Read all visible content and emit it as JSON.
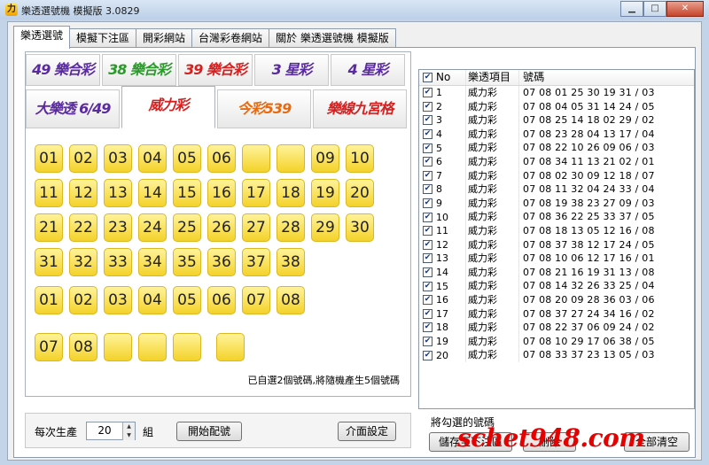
{
  "window": {
    "title": "樂透選號機 模擬版 3.0829",
    "icon_text": "力"
  },
  "tabs": [
    "樂透選號",
    "模擬下注區",
    "開彩網站",
    "台灣彩卷網站",
    "關於 樂透選號機 模擬版"
  ],
  "logos_row1": [
    "49 樂合彩",
    "38 樂合彩",
    "39 樂合彩",
    "3 星彩",
    "4 星彩"
  ],
  "logos_row2": [
    "大樂透 6/49",
    "威力彩",
    "今彩539",
    "樂線九宮格"
  ],
  "numbers": {
    "main_rows": [
      [
        "01",
        "02",
        "03",
        "04",
        "05",
        "06",
        "",
        "",
        "09",
        "10"
      ],
      [
        "11",
        "12",
        "13",
        "14",
        "15",
        "16",
        "17",
        "18",
        "19",
        "20"
      ],
      [
        "21",
        "22",
        "23",
        "24",
        "25",
        "26",
        "27",
        "28",
        "29",
        "30"
      ],
      [
        "31",
        "32",
        "33",
        "34",
        "35",
        "36",
        "37",
        "38"
      ]
    ],
    "second_rows": [
      [
        "01",
        "02",
        "03",
        "04",
        "05",
        "06",
        "07",
        "08"
      ],
      [
        "07",
        "08",
        "",
        "",
        "",
        ""
      ]
    ]
  },
  "hint": "已自選2個號碼,將隨機產生5個號碼",
  "bottom": {
    "label": "每次生產",
    "count": "20",
    "unit": "組",
    "start_button": "開始配號",
    "settings_button": "介面設定"
  },
  "list": {
    "headers": [
      "No",
      "樂透項目",
      "號碼"
    ],
    "rows": [
      {
        "no": "1",
        "game": "威力彩",
        "nums": "07 08 01 25 30 19 31 / 03"
      },
      {
        "no": "2",
        "game": "威力彩",
        "nums": "07 08 04 05 31 14 24 / 05"
      },
      {
        "no": "3",
        "game": "威力彩",
        "nums": "07 08 25 14 18 02 29 / 02"
      },
      {
        "no": "4",
        "game": "威力彩",
        "nums": "07 08 23 28 04 13 17 / 04"
      },
      {
        "no": "5",
        "game": "威力彩",
        "nums": "07 08 22 10 26 09 06 / 03"
      },
      {
        "no": "6",
        "game": "威力彩",
        "nums": "07 08 34 11 13 21 02 / 01"
      },
      {
        "no": "7",
        "game": "威力彩",
        "nums": "07 08 02 30 09 12 18 / 07"
      },
      {
        "no": "8",
        "game": "威力彩",
        "nums": "07 08 11 32 04 24 33 / 04"
      },
      {
        "no": "9",
        "game": "威力彩",
        "nums": "07 08 19 38 23 27 09 / 03"
      },
      {
        "no": "10",
        "game": "威力彩",
        "nums": "07 08 36 22 25 33 37 / 05"
      },
      {
        "no": "11",
        "game": "威力彩",
        "nums": "07 08 18 13 05 12 16 / 08"
      },
      {
        "no": "12",
        "game": "威力彩",
        "nums": "07 08 37 38 12 17 24 / 05"
      },
      {
        "no": "13",
        "game": "威力彩",
        "nums": "07 08 10 06 12 17 16 / 01"
      },
      {
        "no": "14",
        "game": "威力彩",
        "nums": "07 08 21 16 19 31 13 / 08"
      },
      {
        "no": "15",
        "game": "威力彩",
        "nums": "07 08 14 32 26 33 25 / 04"
      },
      {
        "no": "16",
        "game": "威力彩",
        "nums": "07 08 20 09 28 36 03 / 06"
      },
      {
        "no": "17",
        "game": "威力彩",
        "nums": "07 08 37 27 24 34 16 / 02"
      },
      {
        "no": "18",
        "game": "威力彩",
        "nums": "07 08 22 37 06 09 24 / 02"
      },
      {
        "no": "19",
        "game": "威力彩",
        "nums": "07 08 10 29 17 06 38 / 05"
      },
      {
        "no": "20",
        "game": "威力彩",
        "nums": "07 08 33 37 23 13 05 / 03"
      }
    ]
  },
  "selection_group": {
    "label": "將勾選的號碼",
    "save_button": "儲存至下注區",
    "delete_button": "刪除",
    "clear_button": "全部清空"
  },
  "watermark": "schet948.com"
}
